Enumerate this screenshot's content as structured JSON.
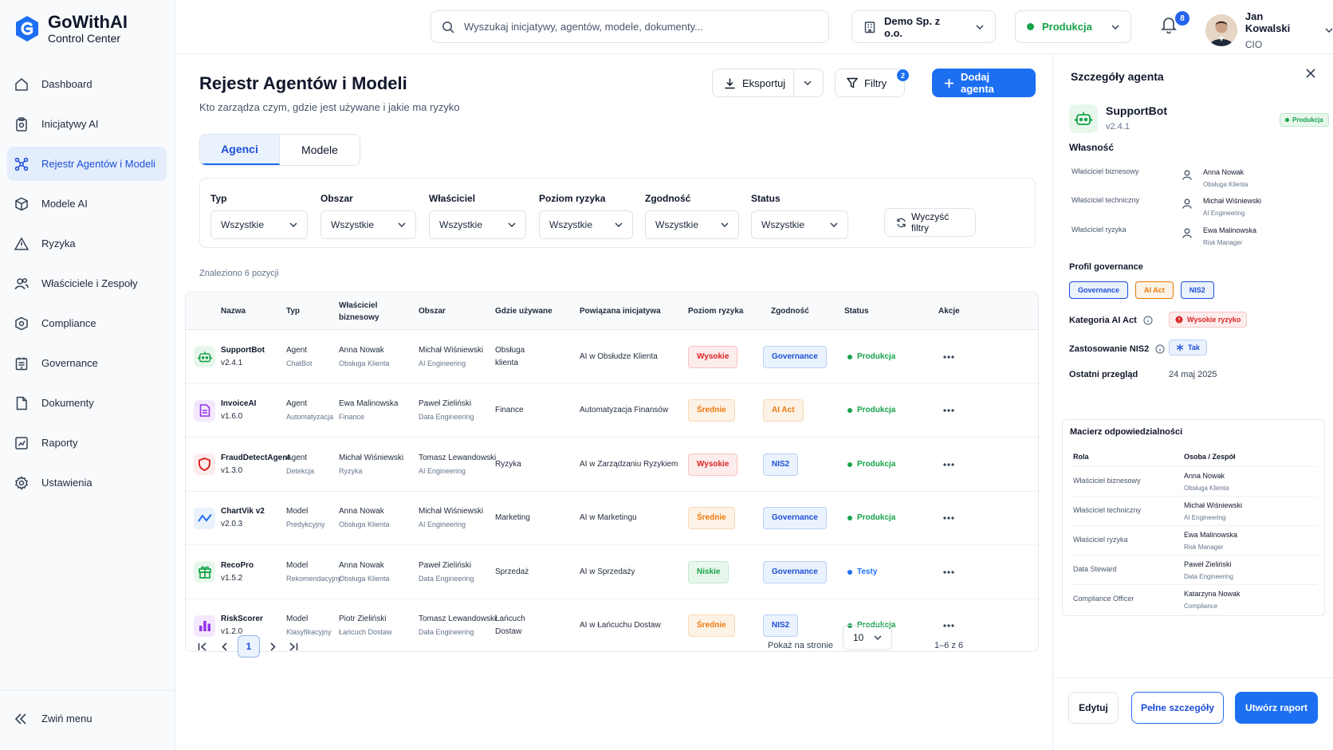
{
  "brand": {
    "title": "GoWithAI",
    "subtitle": "Control Center",
    "accent": "#1d6ff2"
  },
  "sidebar": {
    "items": [
      {
        "label": "Dashboard",
        "icon": "home-icon"
      },
      {
        "label": "Inicjatywy AI",
        "icon": "clipboard-icon"
      },
      {
        "label": "Rejestr Agentów i Modeli",
        "icon": "network-icon",
        "active": true
      },
      {
        "label": "Modele AI",
        "icon": "cube-icon"
      },
      {
        "label": "Ryzyka",
        "icon": "warning-icon"
      },
      {
        "label": "Właściciele i Zespoły",
        "icon": "users-icon"
      },
      {
        "label": "Compliance",
        "icon": "shield-check-icon"
      },
      {
        "label": "Governance",
        "icon": "building-icon"
      },
      {
        "label": "Dokumenty",
        "icon": "file-icon"
      },
      {
        "label": "Raporty",
        "icon": "chart-icon"
      },
      {
        "label": "Ustawienia",
        "icon": "gear-icon"
      }
    ],
    "collapse_label": "Zwiń menu"
  },
  "topbar": {
    "search_placeholder": "Wyszukaj inicjatywy, agentów, modele, dokumenty...",
    "org": "Demo Sp. z o.o.",
    "env": "Produkcja",
    "notifications": "8",
    "user_name": "Jan Kowalski",
    "user_role": "CIO"
  },
  "page": {
    "title": "Rejestr Agentów i Modeli",
    "subtitle": "Kto zarządza czym, gdzie jest używane i jakie ma ryzyko",
    "export_label": "Eksportuj",
    "filters_label": "Filtry",
    "filters_count": "2",
    "add_label": "Dodaj agenta",
    "tabs": [
      "Agenci",
      "Modele"
    ]
  },
  "filters": {
    "fields": [
      {
        "label": "Typ",
        "value": "Wszystkie"
      },
      {
        "label": "Obszar",
        "value": "Wszystkie"
      },
      {
        "label": "Właściciel",
        "value": "Wszystkie"
      },
      {
        "label": "Poziom ryzyka",
        "value": "Wszystkie"
      },
      {
        "label": "Zgodność",
        "value": "Wszystkie"
      },
      {
        "label": "Status",
        "value": "Wszystkie"
      }
    ],
    "clear_label": "Wyczyść filtry",
    "found": "Znaleziono 6 pozycji"
  },
  "table": {
    "headers": [
      "Nazwa",
      "Typ",
      "Właściciel biznesowy",
      "Obszar",
      "Gdzie używane",
      "Powiązana inicjatywa",
      "Poziom ryzyka",
      "Zgodność",
      "Status",
      "Akcje"
    ],
    "rows": [
      {
        "name": "SupportBot",
        "version": "v2.4.1",
        "type": "Agent",
        "type_sub": "ChatBot",
        "owner": "Anna Nowak",
        "owner_sub": "Obsługa Klienta",
        "area": "Michał Wiśniewski",
        "area_sub": "AI Engineering",
        "used": "Obsługa klienta",
        "initiative": "AI w Obsłudze Klienta",
        "risk": "Wysokie",
        "risk_level": "high",
        "compliance": "Governance",
        "comp_kind": "gov",
        "status": "Produkcja",
        "status_color": "#16a34a",
        "icon": "robot-icon",
        "icon_color": "#16a34a",
        "icon_bg": "#e8f7ec"
      },
      {
        "name": "InvoiceAI",
        "version": "v1.6.0",
        "type": "Agent",
        "type_sub": "Automatyzacja",
        "owner": "Ewa Malinowska",
        "owner_sub": "Finance",
        "area": "Paweł Zieliński",
        "area_sub": "Data Engineering",
        "used": "Finance",
        "initiative": "Automatyzacja Finansów",
        "risk": "Średnie",
        "risk_level": "med",
        "compliance": "AI Act",
        "comp_kind": "ai",
        "status": "Produkcja",
        "status_color": "#16a34a",
        "icon": "invoice-icon",
        "icon_color": "#9333ea",
        "icon_bg": "#f3e8fd"
      },
      {
        "name": "FraudDetectAgent",
        "version": "v1.3.0",
        "type": "Agent",
        "type_sub": "Detekcja",
        "owner": "Michał Wiśniewski",
        "owner_sub": "Ryzyka",
        "area": "Tomasz Lewandowski",
        "area_sub": "AI Engineering",
        "used": "Ryzyka",
        "initiative": "AI w Zarządzaniu Ryzykiem",
        "risk": "Wysokie",
        "risk_level": "high",
        "compliance": "NIS2",
        "comp_kind": "gov",
        "status": "Produkcja",
        "status_color": "#16a34a",
        "icon": "shield-icon",
        "icon_color": "#dc2626",
        "icon_bg": "#fdecec"
      },
      {
        "name": "ChartVik v2",
        "version": "v2.0.3",
        "type": "Model",
        "type_sub": "Predykcyjny",
        "owner": "Anna Nowak",
        "owner_sub": "Obsługa Klienta",
        "area": "Michał Wiśniewski",
        "area_sub": "AI Engineering",
        "used": "Marketing",
        "initiative": "AI w Marketingu",
        "risk": "Średnie",
        "risk_level": "med",
        "compliance": "Governance",
        "comp_kind": "gov",
        "status": "Produkcja",
        "status_color": "#16a34a",
        "icon": "trend-icon",
        "icon_color": "#1d6ff2",
        "icon_bg": "#eaf2fd"
      },
      {
        "name": "RecoPro",
        "version": "v1.5.2",
        "type": "Model",
        "type_sub": "Rekomendacyjny",
        "owner": "Anna Nowak",
        "owner_sub": "Obsługa Klienta",
        "area": "Paweł Zieliński",
        "area_sub": "Data Engineering",
        "used": "Sprzedaż",
        "initiative": "AI w Sprzedaży",
        "risk": "Niskie",
        "risk_level": "low",
        "compliance": "Governance",
        "comp_kind": "gov",
        "status": "Testy",
        "status_color": "#1d6ff2",
        "icon": "gift-icon",
        "icon_color": "#16a34a",
        "icon_bg": "#e8f7ec"
      },
      {
        "name": "RiskScorer",
        "version": "v1.2.0",
        "type": "Model",
        "type_sub": "Klasyfikacyjny",
        "owner": "Piotr Zieliński",
        "owner_sub": "Łańcuch Dostaw",
        "area": "Tomasz Lewandowski",
        "area_sub": "Data Engineering",
        "used": "Łańcuch Dostaw",
        "initiative": "AI w Łańcuchu Dostaw",
        "risk": "Średnie",
        "risk_level": "med",
        "compliance": "NIS2",
        "comp_kind": "gov",
        "status": "Produkcja",
        "status_color": "#16a34a",
        "icon": "bars-icon",
        "icon_color": "#9333ea",
        "icon_bg": "#f3e8fd"
      }
    ]
  },
  "pagination": {
    "current": "1",
    "per_page_label": "Pokaż na stronie",
    "per_page": "10",
    "range": "1–6 z 6"
  },
  "panel": {
    "title": "Szczegóły agenta",
    "name": "SupportBot",
    "version": "v2.4.1",
    "status": "Produkcja",
    "ownership_title": "Własność",
    "owners": [
      {
        "label": "Właściciel biznesowy",
        "name": "Anna Nowak",
        "team": "Obsługa Klienta"
      },
      {
        "label": "Właściciel techniczny",
        "name": "Michał Wiśniewski",
        "team": "AI Engineering"
      },
      {
        "label": "Właściciel ryzyka",
        "name": "Ewa Malinowska",
        "team": "Risk Manager"
      }
    ],
    "governance_title": "Profil governance",
    "governance_tags": [
      "Governance",
      "AI Act",
      "NIS2"
    ],
    "ai_act_label": "Kategoria AI Act",
    "ai_act_value": "Wysokie ryzyko",
    "nis2_label": "Zastosowanie NIS2",
    "nis2_value": "Tak",
    "review_label": "Ostatni przegląd",
    "review_value": "24 maj 2025",
    "matrix_title": "Macierz odpowiedzialności",
    "matrix_headers": [
      "Rola",
      "Osoba / Zespół"
    ],
    "matrix": [
      {
        "role": "Właściciel biznesowy",
        "name": "Anna Nowak",
        "team": "Obsługa Klienta"
      },
      {
        "role": "Właściciel techniczny",
        "name": "Michał Wiśniewski",
        "team": "AI Engineering"
      },
      {
        "role": "Właściciel ryzyka",
        "name": "Ewa Malinowska",
        "team": "Risk Manager"
      },
      {
        "role": "Data Steward",
        "name": "Paweł Zieliński",
        "team": "Data Engineering"
      },
      {
        "role": "Compliance Officer",
        "name": "Katarzyna Nowak",
        "team": "Compliance"
      }
    ],
    "edit_label": "Edytuj",
    "details_label": "Pełne szczegóły",
    "report_label": "Utwórz raport"
  }
}
